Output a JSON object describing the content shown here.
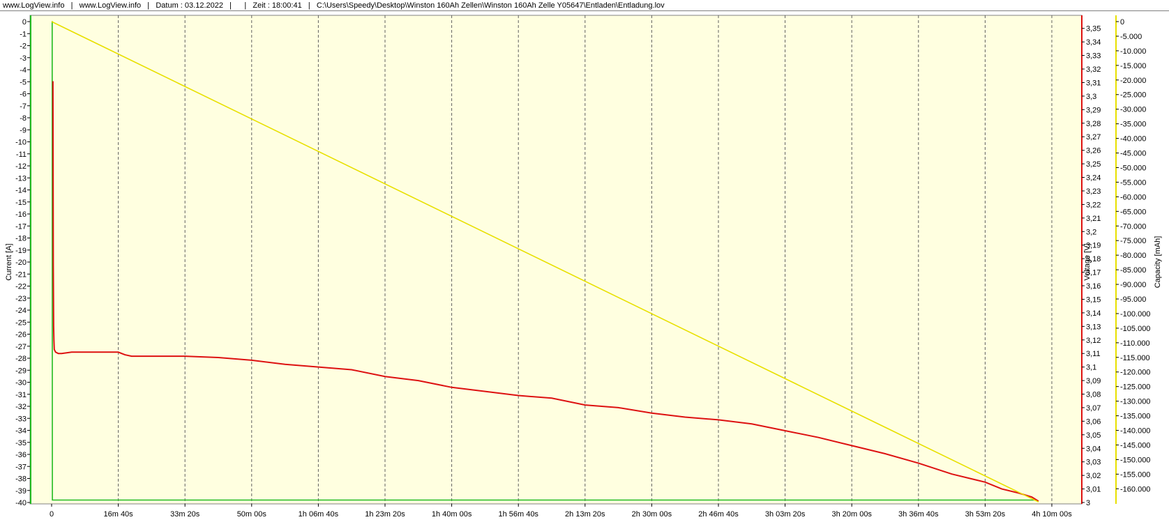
{
  "header": {
    "site1": "www.LogView.info",
    "site2": "www.LogView.info",
    "date": "Datum : 03.12.2022",
    "time": "Zeit : 18:00:41",
    "path": "C:\\Users\\Speedy\\Desktop\\Winston 160Ah Zellen\\Winston 160Ah Zelle Y05647\\Entladen\\Entladung.lov"
  },
  "chart_data": {
    "type": "line",
    "background": "#ffffe0",
    "grid": "vertical-dashed",
    "x_axis": {
      "unit": "seconds",
      "range": [
        0,
        15000
      ],
      "ticks": [
        {
          "value": 0,
          "label": "0"
        },
        {
          "value": 1000,
          "label": "16m 40s"
        },
        {
          "value": 2000,
          "label": "33m 20s"
        },
        {
          "value": 3000,
          "label": "50m 00s"
        },
        {
          "value": 4000,
          "label": "1h 06m 40s"
        },
        {
          "value": 5000,
          "label": "1h 23m 20s"
        },
        {
          "value": 6000,
          "label": "1h 40m 00s"
        },
        {
          "value": 7000,
          "label": "1h 56m 40s"
        },
        {
          "value": 8000,
          "label": "2h 13m 20s"
        },
        {
          "value": 9000,
          "label": "2h 30m 00s"
        },
        {
          "value": 10000,
          "label": "2h 46m 40s"
        },
        {
          "value": 11000,
          "label": "3h 03m 20s"
        },
        {
          "value": 12000,
          "label": "3h 20m 00s"
        },
        {
          "value": 13000,
          "label": "3h 36m 40s"
        },
        {
          "value": 14000,
          "label": "3h 53m 20s"
        },
        {
          "value": 15000,
          "label": "4h 10m 00s"
        }
      ]
    },
    "axes": {
      "current": {
        "label": "Current [A]",
        "side": "left",
        "range": [
          -40,
          0
        ],
        "color": "#22bb22",
        "ticks": [
          "0",
          "-1",
          "-2",
          "-3",
          "-4",
          "-5",
          "-6",
          "-7",
          "-8",
          "-9",
          "-10",
          "-11",
          "-12",
          "-13",
          "-14",
          "-15",
          "-16",
          "-17",
          "-18",
          "-19",
          "-20",
          "-21",
          "-22",
          "-23",
          "-24",
          "-25",
          "-26",
          "-27",
          "-28",
          "-29",
          "-30",
          "-31",
          "-32",
          "-33",
          "-34",
          "-35",
          "-36",
          "-37",
          "-38",
          "-39",
          "-40"
        ]
      },
      "voltage": {
        "label": "Voltage [V]",
        "side": "right",
        "range": [
          3.0,
          3.355
        ],
        "color": "#dd1111",
        "ticks": [
          "3,35",
          "3,34",
          "3,33",
          "3,32",
          "3,31",
          "3,3",
          "3,29",
          "3,28",
          "3,27",
          "3,26",
          "3,25",
          "3,24",
          "3,23",
          "3,22",
          "3,21",
          "3,2",
          "3,19",
          "3,18",
          "3,17",
          "3,16",
          "3,15",
          "3,14",
          "3,13",
          "3,12",
          "3,11",
          "3,1",
          "3,09",
          "3,08",
          "3,07",
          "3,06",
          "3,05",
          "3,04",
          "3,03",
          "3,02",
          "3,01",
          "3"
        ]
      },
      "capacity": {
        "label": "Capacity [mAh]",
        "side": "right",
        "range": [
          -164700,
          0
        ],
        "color": "#e8e000",
        "ticks": [
          "0",
          "-5.000",
          "-10.000",
          "-15.000",
          "-20.000",
          "-25.000",
          "-30.000",
          "-35.000",
          "-40.000",
          "-45.000",
          "-50.000",
          "-55.000",
          "-60.000",
          "-65.000",
          "-70.000",
          "-75.000",
          "-80.000",
          "-85.000",
          "-90.000",
          "-95.000",
          "-100.000",
          "-105.000",
          "-110.000",
          "-115.000",
          "-120.000",
          "-125.000",
          "-130.000",
          "-135.000",
          "-140.000",
          "-145.000",
          "-150.000",
          "-155.000",
          "-160.000"
        ]
      }
    },
    "series": [
      {
        "axis": "current",
        "color": "#22bb22",
        "x": [
          0,
          8,
          10,
          12,
          14000,
          14750,
          14800
        ],
        "y": [
          0,
          0,
          -30,
          -39.8,
          -39.8,
          -39.8,
          -39.9
        ]
      },
      {
        "axis": "voltage",
        "color": "#dd1111",
        "x": [
          20,
          25,
          30,
          35,
          40,
          60,
          100,
          150,
          300,
          600,
          1000,
          1100,
          1200,
          1500,
          2000,
          2500,
          3000,
          3500,
          4000,
          4500,
          5000,
          5500,
          6000,
          6500,
          7000,
          7500,
          8000,
          8500,
          9000,
          9500,
          10000,
          10500,
          11000,
          11500,
          12000,
          12500,
          13000,
          13500,
          14000,
          14250,
          14500,
          14700,
          14800
        ],
        "y": [
          3.311,
          3.175,
          3.13,
          3.12,
          3.113,
          3.111,
          3.11,
          3.11,
          3.111,
          3.111,
          3.111,
          3.109,
          3.108,
          3.108,
          3.108,
          3.107,
          3.105,
          3.102,
          3.1,
          3.098,
          3.093,
          3.09,
          3.085,
          3.082,
          3.079,
          3.077,
          3.072,
          3.07,
          3.066,
          3.063,
          3.061,
          3.058,
          3.053,
          3.048,
          3.042,
          3.036,
          3.029,
          3.021,
          3.015,
          3.01,
          3.007,
          3.004,
          3.001
        ]
      },
      {
        "axis": "capacity",
        "color": "#e8e000",
        "x": [
          0,
          14800
        ],
        "y": [
          0,
          -164500
        ]
      }
    ]
  }
}
